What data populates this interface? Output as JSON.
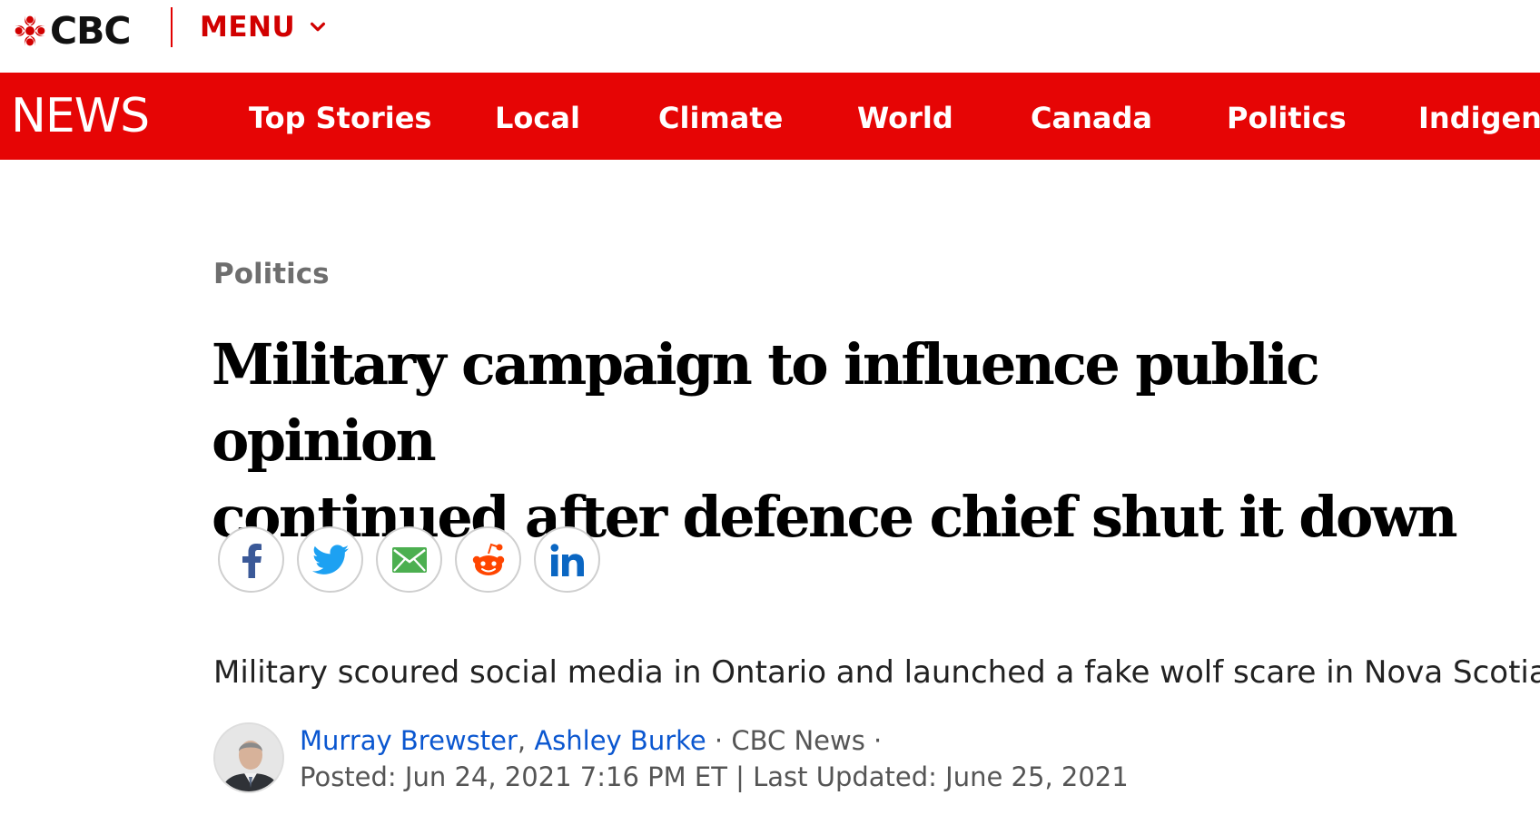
{
  "brand": {
    "logo_text": "CBC",
    "menu_label": "MENU"
  },
  "newsnav": {
    "section_title": "NEWS",
    "items": [
      {
        "label": "Top Stories"
      },
      {
        "label": "Local"
      },
      {
        "label": "Climate"
      },
      {
        "label": "World"
      },
      {
        "label": "Canada"
      },
      {
        "label": "Politics"
      },
      {
        "label": "Indigeno"
      }
    ]
  },
  "article": {
    "section": "Politics",
    "headline_line1": "Military campaign to influence public opinion",
    "headline_line2": "continued after defence chief shut it down",
    "share": [
      {
        "name": "facebook-icon",
        "color": "#3b5998"
      },
      {
        "name": "twitter-icon",
        "color": "#1da1f2"
      },
      {
        "name": "email-icon",
        "color": "#4caf50"
      },
      {
        "name": "reddit-icon",
        "color": "#ff4500"
      },
      {
        "name": "linkedin-icon",
        "color": "#0a66c2"
      }
    ],
    "deck": "Military scoured social media in Ontario and launched a fake wolf scare in Nova Scotia",
    "byline": {
      "author1": "Murray Brewster",
      "separator": ", ",
      "author2": "Ashley Burke",
      "outlet": " · CBC News ·",
      "posted": "Posted: Jun 24, 2021 7:16 PM ET | Last Updated: June 25, 2021"
    }
  },
  "colors": {
    "brand_red": "#e60505",
    "link_blue": "#0b57d0"
  }
}
